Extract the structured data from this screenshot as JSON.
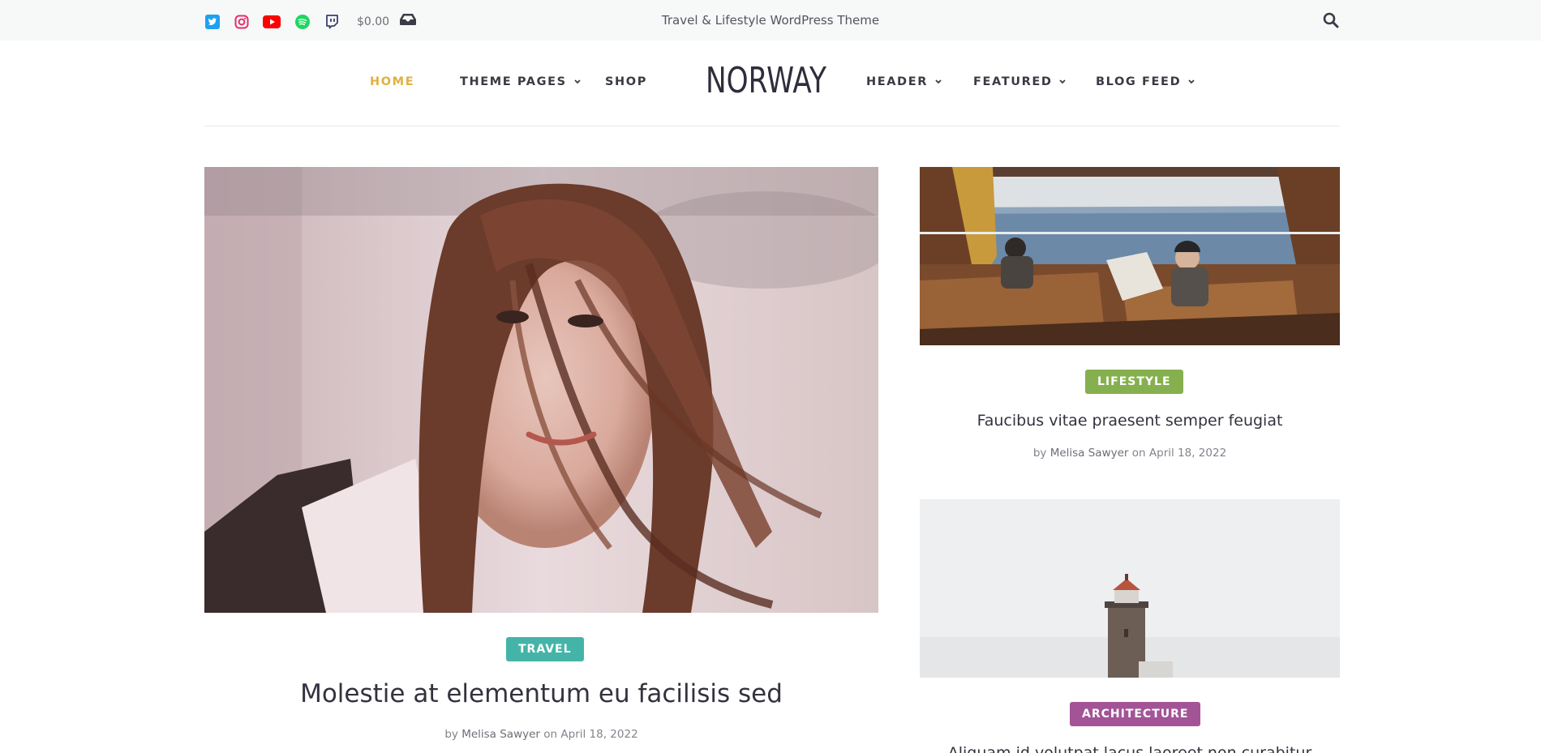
{
  "topbar": {
    "social_icons": [
      "twitter-icon",
      "instagram-icon",
      "youtube-icon",
      "spotify-icon",
      "twitch-icon"
    ],
    "cart_amount": "$0.00",
    "cart_icon": "cart-icon",
    "tagline": "Travel & Lifestyle WordPress Theme",
    "search_icon": "search-icon"
  },
  "nav": {
    "logo": "NORWAY",
    "items_left": [
      {
        "label": "HOME",
        "active": true,
        "dropdown": false
      },
      {
        "label": "THEME PAGES",
        "active": false,
        "dropdown": true
      },
      {
        "label": "SHOP",
        "active": false,
        "dropdown": false
      }
    ],
    "items_right": [
      {
        "label": "HEADER",
        "active": false,
        "dropdown": true
      },
      {
        "label": "FEATURED",
        "active": false,
        "dropdown": true
      },
      {
        "label": "BLOG FEED",
        "active": false,
        "dropdown": true
      }
    ],
    "active_color": "#e0b043"
  },
  "featured": {
    "category": "TRAVEL",
    "category_color": "#45b4a8",
    "title": "Molestie at elementum eu facilisis sed",
    "meta_by": "by",
    "author": "Melisa Sawyer",
    "meta_on": "on",
    "date": "April 18, 2022"
  },
  "side_posts": [
    {
      "category": "LIFESTYLE",
      "category_color": "#86b04f",
      "title": "Faucibus vitae praesent semper feugiat",
      "meta_by": "by",
      "author": "Melisa Sawyer",
      "meta_on": "on",
      "date": "April 18, 2022"
    },
    {
      "category": "ARCHITECTURE",
      "category_color": "#a35497",
      "title": "Aliquam id volutpat lacus laoreet non curabitur"
    }
  ]
}
